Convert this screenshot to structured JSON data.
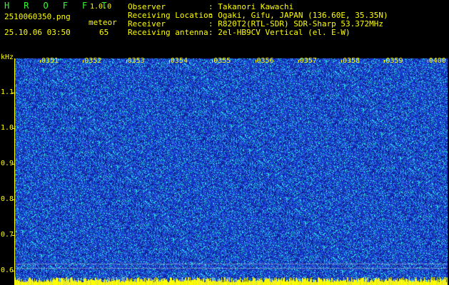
{
  "header": {
    "app_title": "H R O F F T",
    "version": "1.0.0",
    "filename": "2510060350.png",
    "datetime": "25.10.06 03:50",
    "meteor_label": "meteor",
    "meteor_count": "65",
    "observer_label": "Observer",
    "observer_value": ": Takanori Kawachi",
    "location_label": "Receiving Location",
    "location_value": ": Ogaki, Gifu, JAPAN (136.60E, 35.35N)",
    "receiver_label": "Receiver",
    "receiver_value": ": R820T2(RTL-SDR) SDR-Sharp 53.372MHz",
    "antenna_label": "Receiving antenna",
    "antenna_value": ": 2el-HB9CV Vertical (el. E-W)"
  },
  "spectrogram": {
    "unit_label": "kHz",
    "time_ticks": [
      "0351",
      "0352",
      "0353",
      "0354",
      "0355",
      "0356",
      "0357",
      "0358",
      "0359",
      "0400"
    ],
    "freq_ticks": [
      "1.1",
      "1.0",
      "0.9",
      "0.8",
      "0.7",
      "0.6"
    ],
    "colors": {
      "background": "#1a2fb0",
      "noise_cyan": "#2ee8e8",
      "marker": "#ffff00"
    }
  }
}
